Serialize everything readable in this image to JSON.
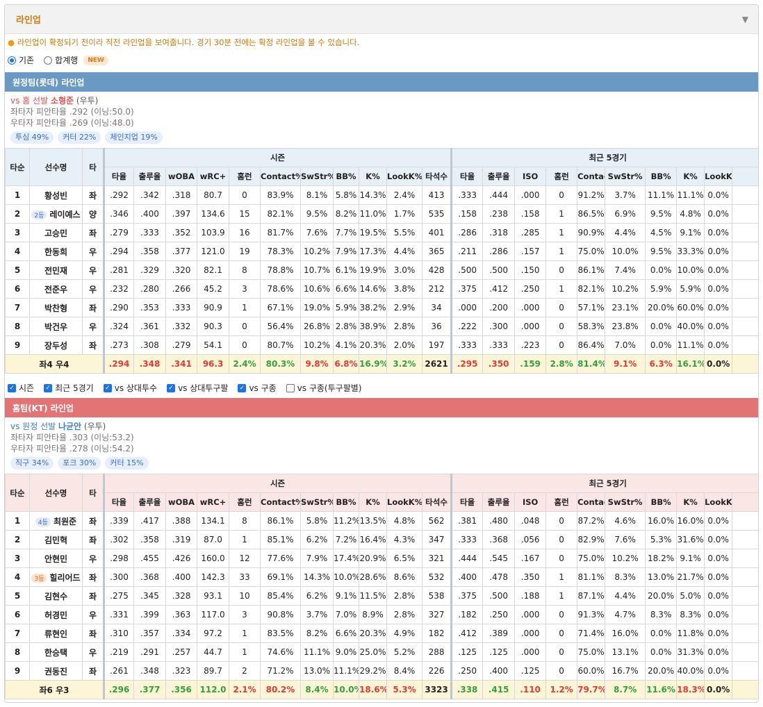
{
  "card": {
    "title": "라인업",
    "collapse_icon": "▼"
  },
  "notice": {
    "bullet": "●",
    "text": "라인업이 확정되기 전이라 직전 라인업을 보여줍니다. 경기 30분 전에는 확정 라인업을 볼 수 있습니다."
  },
  "mode": {
    "options": [
      "기존",
      "합계행"
    ],
    "selected": "기존",
    "new_badge": "NEW"
  },
  "header": {
    "order": "타순",
    "player": "선수명",
    "hand": "타",
    "season_group": "시즌",
    "recent_group": "최근 5경기",
    "season_cols": [
      "타율",
      "출루율",
      "wOBA",
      "wRC+",
      "홈런",
      "Contact%",
      "SwStr%",
      "BB%",
      "K%",
      "LookK%",
      "타석수"
    ],
    "recent_cols": [
      "타율",
      "출루율",
      "ISO",
      "홈런",
      "Contact%",
      "SwStr%",
      "BB%",
      "K%",
      "LookK%"
    ]
  },
  "away": {
    "bar_title": "원정팀(롯데) 라인업",
    "vs_prefix": "vs 홈 선발 ",
    "pitcher": "소형준",
    "pitcher_hand": "(우투)",
    "split_left": "좌타자 피안타율 .292 (이닝:50.0)",
    "split_right": "우타자 피안타율 .269 (이닝:48.0)",
    "pitches": [
      "투심 49%",
      "커터 22%",
      "체인지업 19%"
    ],
    "rows": [
      {
        "order": "1",
        "badge": "",
        "name": "황성빈",
        "hand": "좌",
        "season": [
          ".292",
          ".342",
          ".318",
          "80.7",
          "0",
          "83.9%",
          "8.1%",
          "5.8%",
          "14.3%",
          "2.4%",
          "413"
        ],
        "recent": [
          ".333",
          ".444",
          ".000",
          "0",
          "91.2%",
          "3.7%",
          "11.1%",
          "11.1%",
          "0.0%"
        ]
      },
      {
        "order": "2",
        "badge": "2등",
        "name": "레이예스",
        "hand": "양",
        "season": [
          ".346",
          ".400",
          ".397",
          "134.6",
          "15",
          "82.1%",
          "9.5%",
          "8.2%",
          "11.0%",
          "1.7%",
          "535"
        ],
        "recent": [
          ".158",
          ".238",
          ".158",
          "1",
          "86.5%",
          "6.9%",
          "9.5%",
          "4.8%",
          "0.0%"
        ]
      },
      {
        "order": "3",
        "badge": "",
        "name": "고승민",
        "hand": "좌",
        "season": [
          ".279",
          ".333",
          ".352",
          "103.9",
          "16",
          "81.7%",
          "7.6%",
          "7.7%",
          "19.5%",
          "5.5%",
          "401"
        ],
        "recent": [
          ".286",
          ".318",
          ".285",
          "1",
          "90.9%",
          "4.4%",
          "4.5%",
          "9.1%",
          "0.0%"
        ]
      },
      {
        "order": "4",
        "badge": "",
        "name": "한동희",
        "hand": "우",
        "season": [
          ".294",
          ".358",
          ".377",
          "121.0",
          "19",
          "78.3%",
          "10.2%",
          "7.9%",
          "17.3%",
          "4.4%",
          "365"
        ],
        "recent": [
          ".211",
          ".286",
          ".157",
          "1",
          "75.0%",
          "10.0%",
          "9.5%",
          "33.3%",
          "0.0%"
        ]
      },
      {
        "order": "5",
        "badge": "",
        "name": "전민재",
        "hand": "우",
        "season": [
          ".281",
          ".329",
          ".320",
          "82.1",
          "8",
          "78.8%",
          "10.7%",
          "6.1%",
          "19.9%",
          "3.0%",
          "428"
        ],
        "recent": [
          ".500",
          ".500",
          ".150",
          "0",
          "86.1%",
          "7.4%",
          "0.0%",
          "10.0%",
          "0.0%"
        ]
      },
      {
        "order": "6",
        "badge": "",
        "name": "전준우",
        "hand": "우",
        "season": [
          ".232",
          ".280",
          ".266",
          "45.2",
          "3",
          "78.6%",
          "10.6%",
          "6.6%",
          "14.6%",
          "3.8%",
          "212"
        ],
        "recent": [
          ".375",
          ".412",
          ".250",
          "1",
          "82.1%",
          "10.2%",
          "5.9%",
          "5.9%",
          "0.0%"
        ]
      },
      {
        "order": "7",
        "badge": "",
        "name": "박찬형",
        "hand": "좌",
        "season": [
          ".290",
          ".353",
          ".333",
          "90.9",
          "1",
          "67.1%",
          "19.0%",
          "5.9%",
          "38.2%",
          "2.9%",
          "34"
        ],
        "recent": [
          ".000",
          ".200",
          ".000",
          "0",
          "57.1%",
          "23.1%",
          "20.0%",
          "60.0%",
          "0.0%"
        ]
      },
      {
        "order": "8",
        "badge": "",
        "name": "박건우",
        "hand": "우",
        "season": [
          ".324",
          ".361",
          ".332",
          "90.3",
          "0",
          "56.4%",
          "26.8%",
          "2.8%",
          "38.9%",
          "2.8%",
          "36"
        ],
        "recent": [
          ".222",
          ".300",
          ".000",
          "0",
          "58.3%",
          "23.8%",
          "0.0%",
          "40.0%",
          "0.0%"
        ]
      },
      {
        "order": "9",
        "badge": "",
        "name": "장두성",
        "hand": "좌",
        "season": [
          ".273",
          ".308",
          ".279",
          "54.1",
          "0",
          "80.7%",
          "10.2%",
          "4.1%",
          "20.3%",
          "2.0%",
          "197"
        ],
        "recent": [
          ".333",
          ".333",
          ".223",
          "0",
          "86.4%",
          "7.0%",
          "0.0%",
          "11.1%",
          "0.0%"
        ]
      }
    ],
    "total_label": "좌4 우4",
    "total_season": [
      ".294",
      ".348",
      ".341",
      "96.3",
      "2.4%",
      "80.3%",
      "9.8%",
      "6.8%",
      "16.9%",
      "3.2%",
      "2621"
    ],
    "total_season_colors": [
      "red",
      "red",
      "red",
      "red",
      "green",
      "green",
      "red",
      "red",
      "green",
      "green",
      ""
    ],
    "total_recent": [
      ".295",
      ".350",
      ".159",
      "2.8%",
      "81.4%",
      "9.1%",
      "6.3%",
      "16.1%",
      "0.0%"
    ],
    "total_recent_colors": [
      "red",
      "red",
      "green",
      "green",
      "green",
      "red",
      "red",
      "green",
      ""
    ]
  },
  "filters": [
    {
      "label": "시즌",
      "checked": true
    },
    {
      "label": "최근 5경기",
      "checked": true
    },
    {
      "label": "vs 상대투수",
      "checked": true
    },
    {
      "label": "vs 상대투구팔",
      "checked": true
    },
    {
      "label": "vs 구종",
      "checked": true
    },
    {
      "label": "vs 구종(투구팔별)",
      "checked": false
    }
  ],
  "home": {
    "bar_title": "홈팀(KT) 라인업",
    "vs_prefix": "vs 원정 선발 ",
    "pitcher": "나균안",
    "pitcher_hand": "(우투)",
    "split_left": "좌타자 피안타율 .303 (이닝:53.2)",
    "split_right": "우타자 피안타율 .278 (이닝:54.2)",
    "pitches": [
      "직구 34%",
      "포크 30%",
      "커터 15%"
    ],
    "rows": [
      {
        "order": "1",
        "badge": "4등",
        "name": "최원준",
        "hand": "좌",
        "season": [
          ".339",
          ".417",
          ".388",
          "134.1",
          "8",
          "86.1%",
          "5.8%",
          "11.2%",
          "13.5%",
          "4.8%",
          "562"
        ],
        "recent": [
          ".381",
          ".480",
          ".048",
          "0",
          "87.2%",
          "4.6%",
          "16.0%",
          "16.0%",
          "0.0%"
        ]
      },
      {
        "order": "2",
        "badge": "",
        "name": "김민혁",
        "hand": "좌",
        "season": [
          ".302",
          ".358",
          ".319",
          "87.0",
          "1",
          "85.1%",
          "6.2%",
          "7.2%",
          "16.4%",
          "4.3%",
          "347"
        ],
        "recent": [
          ".333",
          ".368",
          ".056",
          "0",
          "82.9%",
          "7.6%",
          "5.3%",
          "31.6%",
          "0.0%"
        ]
      },
      {
        "order": "3",
        "badge": "",
        "name": "안현민",
        "hand": "우",
        "season": [
          ".298",
          ".455",
          ".426",
          "160.0",
          "12",
          "77.6%",
          "7.9%",
          "17.4%",
          "20.9%",
          "6.5%",
          "321"
        ],
        "recent": [
          ".444",
          ".545",
          ".167",
          "0",
          "75.0%",
          "10.2%",
          "18.2%",
          "9.1%",
          "0.0%"
        ]
      },
      {
        "order": "4",
        "badge": "3등",
        "name": "힐리어드",
        "hand": "좌",
        "season": [
          ".300",
          ".368",
          ".400",
          "142.3",
          "33",
          "69.1%",
          "14.3%",
          "10.0%",
          "28.6%",
          "8.6%",
          "532"
        ],
        "recent": [
          ".400",
          ".478",
          ".350",
          "1",
          "81.1%",
          "8.3%",
          "13.0%",
          "21.7%",
          "0.0%"
        ]
      },
      {
        "order": "5",
        "badge": "",
        "name": "김현수",
        "hand": "좌",
        "season": [
          ".275",
          ".345",
          ".328",
          "93.1",
          "10",
          "85.4%",
          "6.2%",
          "9.1%",
          "11.5%",
          "2.8%",
          "538"
        ],
        "recent": [
          ".375",
          ".500",
          ".188",
          "1",
          "87.1%",
          "4.4%",
          "20.0%",
          "5.0%",
          "0.0%"
        ]
      },
      {
        "order": "6",
        "badge": "",
        "name": "허경민",
        "hand": "우",
        "season": [
          ".331",
          ".399",
          ".363",
          "117.0",
          "3",
          "90.8%",
          "3.7%",
          "7.0%",
          "8.9%",
          "2.8%",
          "327"
        ],
        "recent": [
          ".182",
          ".250",
          ".000",
          "0",
          "91.3%",
          "4.7%",
          "8.3%",
          "8.3%",
          "0.0%"
        ]
      },
      {
        "order": "7",
        "badge": "",
        "name": "류현인",
        "hand": "좌",
        "season": [
          ".310",
          ".357",
          ".334",
          "97.2",
          "1",
          "83.5%",
          "8.2%",
          "6.6%",
          "20.3%",
          "4.9%",
          "182"
        ],
        "recent": [
          ".412",
          ".389",
          ".000",
          "0",
          "71.4%",
          "16.0%",
          "0.0%",
          "11.8%",
          "0.0%"
        ]
      },
      {
        "order": "8",
        "badge": "",
        "name": "한승택",
        "hand": "우",
        "season": [
          ".219",
          ".291",
          ".257",
          "44.7",
          "1",
          "74.6%",
          "11.1%",
          "9.0%",
          "25.0%",
          "5.2%",
          "288"
        ],
        "recent": [
          ".125",
          ".125",
          ".000",
          "0",
          "75.0%",
          "13.1%",
          "0.0%",
          "31.3%",
          "0.0%"
        ]
      },
      {
        "order": "9",
        "badge": "",
        "name": "권동진",
        "hand": "좌",
        "season": [
          ".261",
          ".348",
          ".323",
          "89.7",
          "2",
          "71.2%",
          "13.0%",
          "11.1%",
          "29.2%",
          "8.4%",
          "226"
        ],
        "recent": [
          ".250",
          ".400",
          ".125",
          "0",
          "60.0%",
          "16.7%",
          "20.0%",
          "40.0%",
          "0.0%"
        ]
      }
    ],
    "total_label": "좌6 우3",
    "total_season": [
      ".296",
      ".377",
      ".356",
      "112.0",
      "2.1%",
      "80.2%",
      "8.4%",
      "10.0%",
      "18.6%",
      "5.3%",
      "3323"
    ],
    "total_season_colors": [
      "green",
      "green",
      "green",
      "green",
      "red",
      "red",
      "green",
      "green",
      "red",
      "red",
      ""
    ],
    "total_recent": [
      ".338",
      ".415",
      ".110",
      "1.2%",
      "79.7%",
      "8.7%",
      "11.6%",
      "18.3%",
      "0.0%"
    ],
    "total_recent_colors": [
      "green",
      "green",
      "red",
      "red",
      "red",
      "green",
      "green",
      "red",
      ""
    ]
  }
}
